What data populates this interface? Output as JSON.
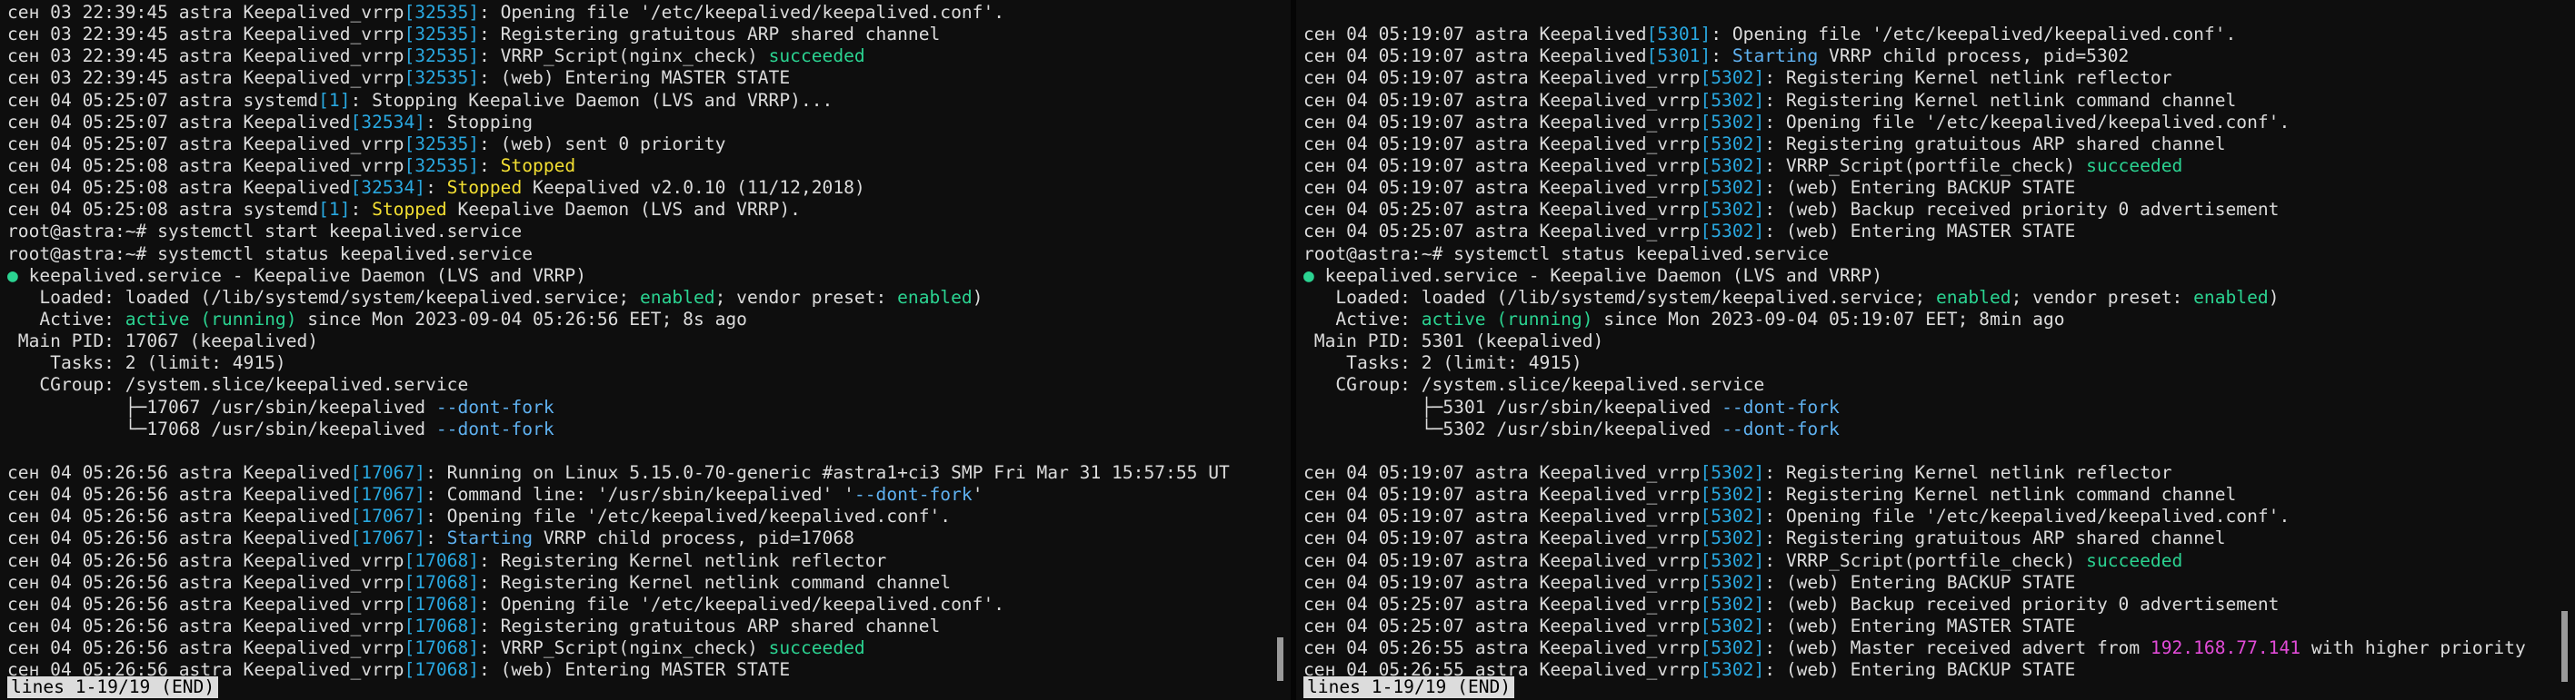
{
  "panes": [
    {
      "lines": [
        [
          {
            "t": "сен 03 22:39:45 astra Keepalived_vrrp"
          },
          {
            "t": "[32535]",
            "c": "pid"
          },
          {
            "t": ": Opening file '/etc/keepalived/keepalived.conf'."
          }
        ],
        [
          {
            "t": "сен 03 22:39:45 astra Keepalived_vrrp"
          },
          {
            "t": "[32535]",
            "c": "pid"
          },
          {
            "t": ": Registering gratuitous ARP shared channel"
          }
        ],
        [
          {
            "t": "сен 03 22:39:45 astra Keepalived_vrrp"
          },
          {
            "t": "[32535]",
            "c": "pid"
          },
          {
            "t": ": VRRP_Script(nginx_check) "
          },
          {
            "t": "succeeded",
            "c": "ok"
          }
        ],
        [
          {
            "t": "сен 03 22:39:45 astra Keepalived_vrrp"
          },
          {
            "t": "[32535]",
            "c": "pid"
          },
          {
            "t": ": (web) Entering MASTER STATE"
          }
        ],
        [
          {
            "t": "сен 04 05:25:07 astra systemd"
          },
          {
            "t": "[1]",
            "c": "pid"
          },
          {
            "t": ": Stopping Keepalive Daemon (LVS and VRRP)..."
          }
        ],
        [
          {
            "t": "сен 04 05:25:07 astra Keepalived"
          },
          {
            "t": "[32534]",
            "c": "pid"
          },
          {
            "t": ": Stopping"
          }
        ],
        [
          {
            "t": "сен 04 05:25:07 astra Keepalived_vrrp"
          },
          {
            "t": "[32535]",
            "c": "pid"
          },
          {
            "t": ": (web) sent 0 priority"
          }
        ],
        [
          {
            "t": "сен 04 05:25:08 astra Keepalived_vrrp"
          },
          {
            "t": "[32535]",
            "c": "pid"
          },
          {
            "t": ": "
          },
          {
            "t": "Stopped",
            "c": "warn"
          }
        ],
        [
          {
            "t": "сен 04 05:25:08 astra Keepalived"
          },
          {
            "t": "[32534]",
            "c": "pid"
          },
          {
            "t": ": "
          },
          {
            "t": "Stopped",
            "c": "warn"
          },
          {
            "t": " Keepalived v2.0.10 (11/12,2018)"
          }
        ],
        [
          {
            "t": "сен 04 05:25:08 astra systemd"
          },
          {
            "t": "[1]",
            "c": "pid"
          },
          {
            "t": ": "
          },
          {
            "t": "Stopped",
            "c": "warn"
          },
          {
            "t": " Keepalive Daemon (LVS and VRRP)."
          }
        ],
        [
          {
            "t": "root@astra:~# systemctl start keepalived.service"
          }
        ],
        [
          {
            "t": "root@astra:~# systemctl status keepalived.service"
          }
        ],
        [
          {
            "t": "●",
            "c": "dot"
          },
          {
            "t": " keepalived.service - Keepalive Daemon (LVS and VRRP)"
          }
        ],
        [
          {
            "t": "   Loaded: loaded (/lib/systemd/system/keepalived.service; "
          },
          {
            "t": "enabled",
            "c": "ok"
          },
          {
            "t": "; vendor preset: "
          },
          {
            "t": "enabled",
            "c": "ok"
          },
          {
            "t": ")"
          }
        ],
        [
          {
            "t": "   Active: "
          },
          {
            "t": "active (running)",
            "c": "ok"
          },
          {
            "t": " since Mon 2023-09-04 05:26:56 EET; 8s ago"
          }
        ],
        [
          {
            "t": " Main PID: 17067 (keepalived)"
          }
        ],
        [
          {
            "t": "    Tasks: 2 (limit: 4915)"
          }
        ],
        [
          {
            "t": "   CGroup: /system.slice/keepalived.service"
          }
        ],
        [
          {
            "t": "           ├─17067 /usr/sbin/keepalived "
          },
          {
            "t": "--dont-fork",
            "c": "opt"
          }
        ],
        [
          {
            "t": "           └─17068 /usr/sbin/keepalived "
          },
          {
            "t": "--dont-fork",
            "c": "opt"
          }
        ],
        [
          {
            "t": ""
          }
        ],
        [
          {
            "t": "сен 04 05:26:56 astra Keepalived"
          },
          {
            "t": "[17067]",
            "c": "pid"
          },
          {
            "t": ": Running on Linux 5.15.0-70-generic #astra1+ci3 SMP Fri Mar 31 15:57:55 UT"
          }
        ],
        [
          {
            "t": "сен 04 05:26:56 astra Keepalived"
          },
          {
            "t": "[17067]",
            "c": "pid"
          },
          {
            "t": ": Command line: '/usr/sbin/keepalived' '"
          },
          {
            "t": "--dont-fork",
            "c": "opt"
          },
          {
            "t": "'"
          }
        ],
        [
          {
            "t": "сен 04 05:26:56 astra Keepalived"
          },
          {
            "t": "[17067]",
            "c": "pid"
          },
          {
            "t": ": Opening file '/etc/keepalived/keepalived.conf'."
          }
        ],
        [
          {
            "t": "сен 04 05:26:56 astra Keepalived"
          },
          {
            "t": "[17067]",
            "c": "pid"
          },
          {
            "t": ": "
          },
          {
            "t": "Starting",
            "c": "opt"
          },
          {
            "t": " VRRP child process, pid=17068"
          }
        ],
        [
          {
            "t": "сен 04 05:26:56 astra Keepalived_vrrp"
          },
          {
            "t": "[17068]",
            "c": "pid"
          },
          {
            "t": ": Registering Kernel netlink reflector"
          }
        ],
        [
          {
            "t": "сен 04 05:26:56 astra Keepalived_vrrp"
          },
          {
            "t": "[17068]",
            "c": "pid"
          },
          {
            "t": ": Registering Kernel netlink command channel"
          }
        ],
        [
          {
            "t": "сен 04 05:26:56 astra Keepalived_vrrp"
          },
          {
            "t": "[17068]",
            "c": "pid"
          },
          {
            "t": ": Opening file '/etc/keepalived/keepalived.conf'."
          }
        ],
        [
          {
            "t": "сен 04 05:26:56 astra Keepalived_vrrp"
          },
          {
            "t": "[17068]",
            "c": "pid"
          },
          {
            "t": ": Registering gratuitous ARP shared channel"
          }
        ],
        [
          {
            "t": "сен 04 05:26:56 astra Keepalived_vrrp"
          },
          {
            "t": "[17068]",
            "c": "pid"
          },
          {
            "t": ": VRRP_Script(nginx_check) "
          },
          {
            "t": "succeeded",
            "c": "ok"
          }
        ],
        [
          {
            "t": "сен 04 05:26:56 astra Keepalived_vrrp"
          },
          {
            "t": "[17068]",
            "c": "pid"
          },
          {
            "t": ": (web) Entering MASTER STATE"
          }
        ]
      ],
      "status": "lines 1-19/19 (END)"
    },
    {
      "lines": [
        [
          {
            "t": ""
          }
        ],
        [
          {
            "t": "сен 04 05:19:07 astra Keepalived"
          },
          {
            "t": "[5301]",
            "c": "pid"
          },
          {
            "t": ": Opening file '/etc/keepalived/keepalived.conf'."
          }
        ],
        [
          {
            "t": "сен 04 05:19:07 astra Keepalived"
          },
          {
            "t": "[5301]",
            "c": "pid"
          },
          {
            "t": ": "
          },
          {
            "t": "Starting",
            "c": "opt"
          },
          {
            "t": " VRRP child process, pid=5302"
          }
        ],
        [
          {
            "t": "сен 04 05:19:07 astra Keepalived_vrrp"
          },
          {
            "t": "[5302]",
            "c": "pid"
          },
          {
            "t": ": Registering Kernel netlink reflector"
          }
        ],
        [
          {
            "t": "сен 04 05:19:07 astra Keepalived_vrrp"
          },
          {
            "t": "[5302]",
            "c": "pid"
          },
          {
            "t": ": Registering Kernel netlink command channel"
          }
        ],
        [
          {
            "t": "сен 04 05:19:07 astra Keepalived_vrrp"
          },
          {
            "t": "[5302]",
            "c": "pid"
          },
          {
            "t": ": Opening file '/etc/keepalived/keepalived.conf'."
          }
        ],
        [
          {
            "t": "сен 04 05:19:07 astra Keepalived_vrrp"
          },
          {
            "t": "[5302]",
            "c": "pid"
          },
          {
            "t": ": Registering gratuitous ARP shared channel"
          }
        ],
        [
          {
            "t": "сен 04 05:19:07 astra Keepalived_vrrp"
          },
          {
            "t": "[5302]",
            "c": "pid"
          },
          {
            "t": ": VRRP_Script(portfile_check) "
          },
          {
            "t": "succeeded",
            "c": "ok"
          }
        ],
        [
          {
            "t": "сен 04 05:19:07 astra Keepalived_vrrp"
          },
          {
            "t": "[5302]",
            "c": "pid"
          },
          {
            "t": ": (web) Entering BACKUP STATE"
          }
        ],
        [
          {
            "t": "сен 04 05:25:07 astra Keepalived_vrrp"
          },
          {
            "t": "[5302]",
            "c": "pid"
          },
          {
            "t": ": (web) Backup received priority 0 advertisement"
          }
        ],
        [
          {
            "t": "сен 04 05:25:07 astra Keepalived_vrrp"
          },
          {
            "t": "[5302]",
            "c": "pid"
          },
          {
            "t": ": (web) Entering MASTER STATE"
          }
        ],
        [
          {
            "t": "root@astra:~# systemctl status keepalived.service"
          }
        ],
        [
          {
            "t": "●",
            "c": "dot"
          },
          {
            "t": " keepalived.service - Keepalive Daemon (LVS and VRRP)"
          }
        ],
        [
          {
            "t": "   Loaded: loaded (/lib/systemd/system/keepalived.service; "
          },
          {
            "t": "enabled",
            "c": "ok"
          },
          {
            "t": "; vendor preset: "
          },
          {
            "t": "enabled",
            "c": "ok"
          },
          {
            "t": ")"
          }
        ],
        [
          {
            "t": "   Active: "
          },
          {
            "t": "active (running)",
            "c": "ok"
          },
          {
            "t": " since Mon 2023-09-04 05:19:07 EET; 8min ago"
          }
        ],
        [
          {
            "t": " Main PID: 5301 (keepalived)"
          }
        ],
        [
          {
            "t": "    Tasks: 2 (limit: 4915)"
          }
        ],
        [
          {
            "t": "   CGroup: /system.slice/keepalived.service"
          }
        ],
        [
          {
            "t": "           ├─5301 /usr/sbin/keepalived "
          },
          {
            "t": "--dont-fork",
            "c": "opt"
          }
        ],
        [
          {
            "t": "           └─5302 /usr/sbin/keepalived "
          },
          {
            "t": "--dont-fork",
            "c": "opt"
          }
        ],
        [
          {
            "t": ""
          }
        ],
        [
          {
            "t": "сен 04 05:19:07 astra Keepalived_vrrp"
          },
          {
            "t": "[5302]",
            "c": "pid"
          },
          {
            "t": ": Registering Kernel netlink reflector"
          }
        ],
        [
          {
            "t": "сен 04 05:19:07 astra Keepalived_vrrp"
          },
          {
            "t": "[5302]",
            "c": "pid"
          },
          {
            "t": ": Registering Kernel netlink command channel"
          }
        ],
        [
          {
            "t": "сен 04 05:19:07 astra Keepalived_vrrp"
          },
          {
            "t": "[5302]",
            "c": "pid"
          },
          {
            "t": ": Opening file '/etc/keepalived/keepalived.conf'."
          }
        ],
        [
          {
            "t": "сен 04 05:19:07 astra Keepalived_vrrp"
          },
          {
            "t": "[5302]",
            "c": "pid"
          },
          {
            "t": ": Registering gratuitous ARP shared channel"
          }
        ],
        [
          {
            "t": "сен 04 05:19:07 astra Keepalived_vrrp"
          },
          {
            "t": "[5302]",
            "c": "pid"
          },
          {
            "t": ": VRRP_Script(portfile_check) "
          },
          {
            "t": "succeeded",
            "c": "ok"
          }
        ],
        [
          {
            "t": "сен 04 05:19:07 astra Keepalived_vrrp"
          },
          {
            "t": "[5302]",
            "c": "pid"
          },
          {
            "t": ": (web) Entering BACKUP STATE"
          }
        ],
        [
          {
            "t": "сен 04 05:25:07 astra Keepalived_vrrp"
          },
          {
            "t": "[5302]",
            "c": "pid"
          },
          {
            "t": ": (web) Backup received priority 0 advertisement"
          }
        ],
        [
          {
            "t": "сен 04 05:25:07 astra Keepalived_vrrp"
          },
          {
            "t": "[5302]",
            "c": "pid"
          },
          {
            "t": ": (web) Entering MASTER STATE"
          }
        ],
        [
          {
            "t": "сен 04 05:26:55 astra Keepalived_vrrp"
          },
          {
            "t": "[5302]",
            "c": "pid"
          },
          {
            "t": ": (web) Master received advert from "
          },
          {
            "t": "192.168.77.141",
            "c": "ip"
          },
          {
            "t": " with higher priority"
          }
        ],
        [
          {
            "t": "сен 04 05:26:55 astra Keepalived_vrrp"
          },
          {
            "t": "[5302]",
            "c": "pid"
          },
          {
            "t": ": (web) Entering BACKUP STATE"
          }
        ]
      ],
      "status": "lines 1-19/19 (END)"
    }
  ],
  "colors": {
    "background": "#0e0e0e",
    "text": "#dcdcdc",
    "pid": "#29a8e0",
    "ok": "#2bd391",
    "warn": "#f3df32",
    "ip": "#e24bd8",
    "opt": "#5fb1f0"
  }
}
